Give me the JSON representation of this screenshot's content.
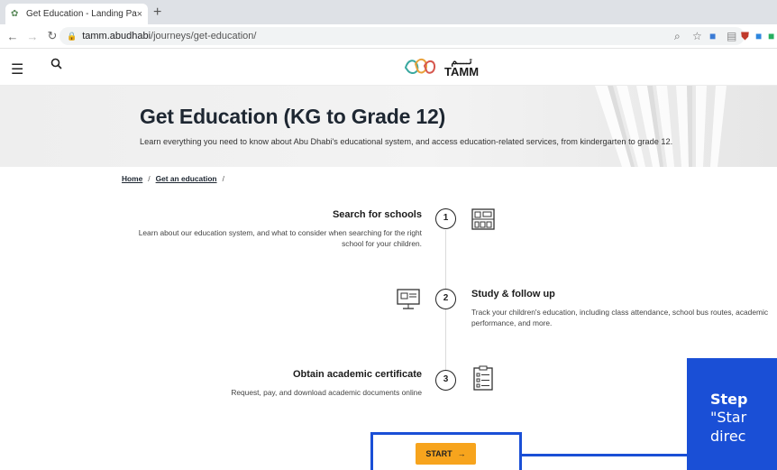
{
  "browser": {
    "tab_title": "Get Education - Landing Page",
    "tab_close": "×",
    "new_tab": "+",
    "url_host": "tamm.abudhabi",
    "url_path": "/journeys/get-education/"
  },
  "header": {
    "logo_text": "TAMM",
    "logo_arabic": "تــــم"
  },
  "hero": {
    "title": "Get Education (KG to Grade 12)",
    "subtitle": "Learn everything you need to know about Abu Dhabi's educational system, and access education-related services, from kindergarten to grade 12."
  },
  "breadcrumb": {
    "home": "Home",
    "separator": "/",
    "current": "Get an education"
  },
  "steps": [
    {
      "number": "1",
      "title": "Search for schools",
      "description": "Learn about our education system, and what to consider when searching for the right school for your children.",
      "icon": "school-building-icon"
    },
    {
      "number": "2",
      "title": "Study & follow up",
      "description": "Track your children's education, including class attendance, school bus routes, academic performance, and more.",
      "icon": "computer-monitor-icon"
    },
    {
      "number": "3",
      "title": "Obtain academic certificate",
      "description": "Request, pay, and download academic documents online",
      "icon": "clipboard-icon"
    }
  ],
  "start_button": {
    "label": "START",
    "arrow": "→"
  },
  "callout": {
    "title": "Step",
    "line1": "\"Star",
    "line2": "direc"
  },
  "colors": {
    "accent_blue": "#1a4fd6",
    "start_orange": "#f7a41d"
  }
}
